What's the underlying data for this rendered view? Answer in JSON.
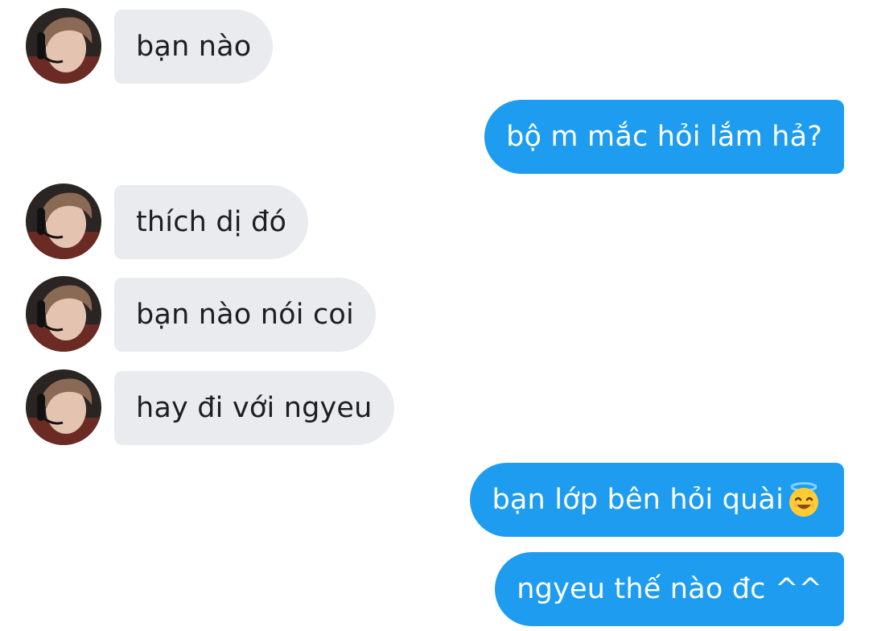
{
  "colors": {
    "incoming_bubble": "#e9ebef",
    "incoming_text": "#1c1e21",
    "outgoing_bubble": "#1d9cf0",
    "outgoing_text": "#ffffff"
  },
  "messages": [
    {
      "sender": "contact",
      "text": "bạn nào",
      "avatar": "contact-avatar"
    },
    {
      "sender": "me",
      "text": "bộ m mắc hỏi lắm hả?"
    },
    {
      "sender": "contact",
      "text": "thích dị đó",
      "avatar": "contact-avatar"
    },
    {
      "sender": "contact",
      "text": "bạn nào nói coi",
      "avatar": "contact-avatar"
    },
    {
      "sender": "contact",
      "text": "hay đi với ngyeu",
      "avatar": "contact-avatar"
    },
    {
      "sender": "me",
      "text": "bạn lớp bên hỏi quài",
      "emoji": "smiling-face-with-halo"
    },
    {
      "sender": "me",
      "text": "ngyeu thế nào đc ^^"
    }
  ]
}
